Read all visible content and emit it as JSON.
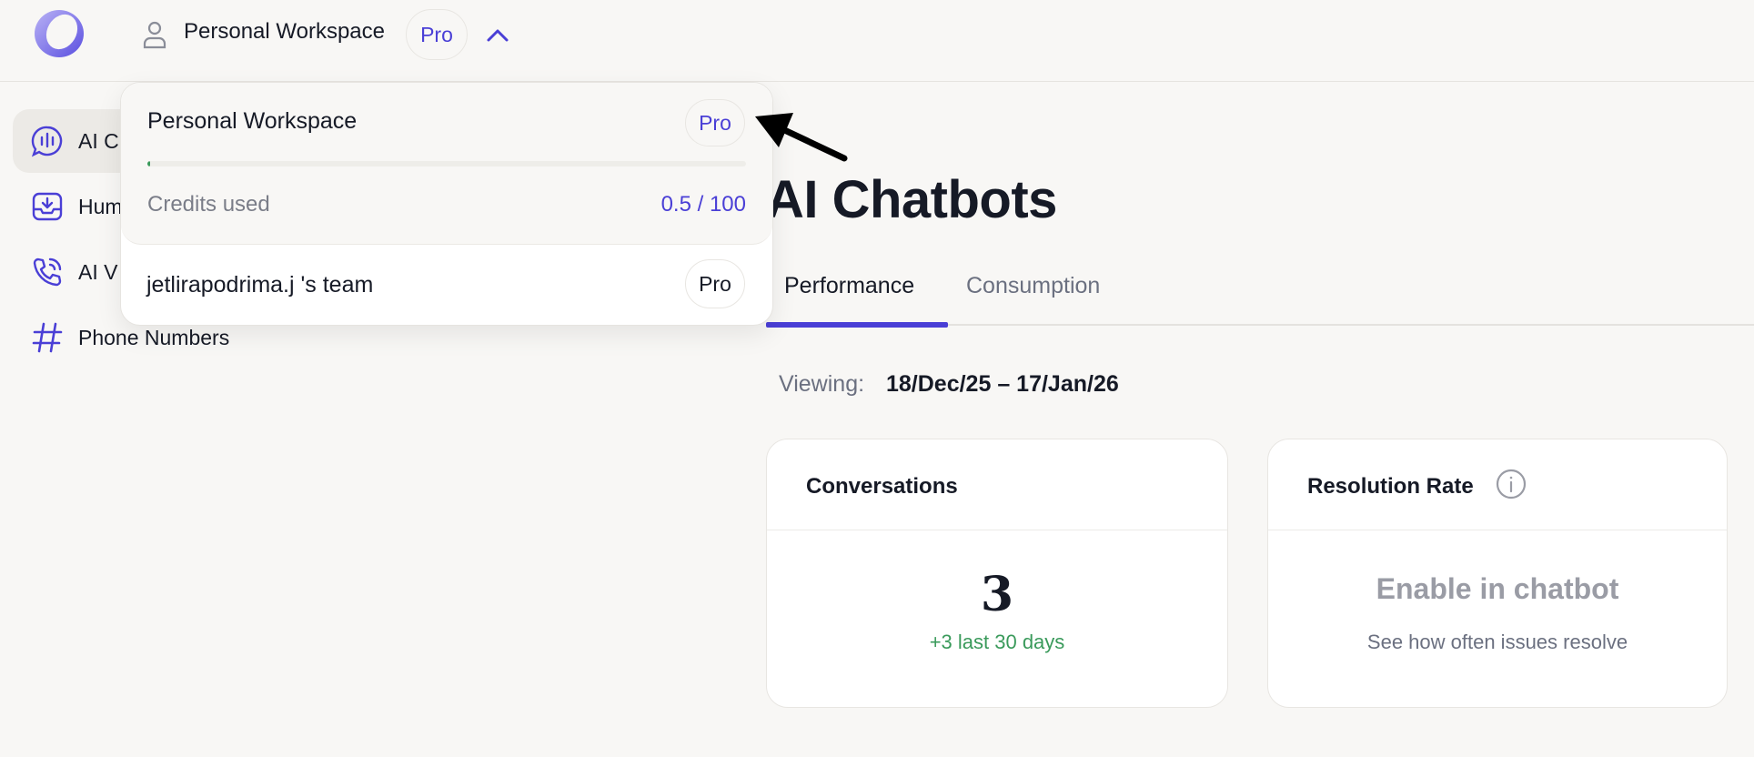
{
  "header": {
    "workspace_name": "Personal Workspace",
    "plan_badge": "Pro"
  },
  "sidebar": {
    "items": [
      {
        "label": "AI C",
        "icon": "chat-bubble-icon",
        "active": true
      },
      {
        "label": "Hum",
        "icon": "inbox-icon",
        "active": false
      },
      {
        "label": "AI V",
        "icon": "phone-call-icon",
        "active": false
      },
      {
        "label": "Phone Numbers",
        "icon": "hash-icon",
        "active": false
      }
    ]
  },
  "main": {
    "title": "AI Chatbots",
    "tabs": [
      {
        "label": "Performance",
        "active": true
      },
      {
        "label": "Consumption",
        "active": false
      }
    ],
    "viewing_label": "Viewing:",
    "viewing_range": "18/Dec/25 – 17/Jan/26",
    "cards": [
      {
        "title": "Conversations",
        "value": "3",
        "delta": "+3 last 30 days"
      },
      {
        "title": "Resolution Rate",
        "value": "Enable in chatbot",
        "subtitle": "See how often issues resolve"
      }
    ]
  },
  "dropdown": {
    "current_workspace": {
      "name": "Personal Workspace",
      "plan": "Pro",
      "credits_label": "Credits used",
      "credits_value": "0.5 / 100",
      "credits_fraction": 0.005
    },
    "other_workspaces": [
      {
        "name": "jetlirapodrima.j 's team",
        "plan": "Pro"
      }
    ]
  },
  "colors": {
    "accent": "#4a3fd6",
    "positive": "#3a9a5b",
    "background": "#f8f7f5"
  }
}
